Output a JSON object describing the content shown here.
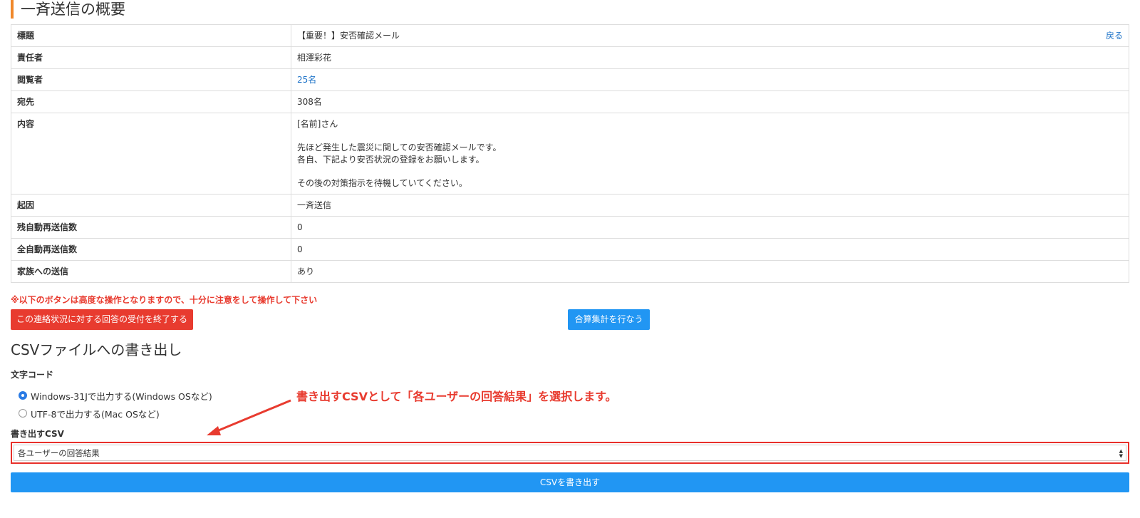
{
  "overview": {
    "title": "一斉送信の概要",
    "back_label": "戻る",
    "rows": [
      {
        "label": "標題",
        "value": "【重要！】安否確認メール"
      },
      {
        "label": "責任者",
        "value": "相澤彩花"
      },
      {
        "label": "閲覧者",
        "value": "25名"
      },
      {
        "label": "宛先",
        "value": "308名"
      },
      {
        "label": "内容",
        "value": "[名前]さん\n\n先ほど発生した震災に関しての安否確認メールです。\n各自、下記より安否状況の登録をお願いします。\n\nその後の対策指示を待機していてください。"
      },
      {
        "label": "起因",
        "value": "一斉送信"
      },
      {
        "label": "残自動再送信数",
        "value": "0"
      },
      {
        "label": "全自動再送信数",
        "value": "0"
      },
      {
        "label": "家族への送信",
        "value": "あり"
      }
    ]
  },
  "actions": {
    "warning": "※以下のボタンは高度な操作となりますので、十分に注意をして操作して下さい",
    "end_button": "この連絡状況に対する回答の受付を終了する",
    "aggregate_button": "合算集計を行なう"
  },
  "csv": {
    "title": "CSVファイルへの書き出し",
    "encoding_label": "文字コード",
    "encoding_options": [
      {
        "label": "Windows-31Jで出力する(Windows OSなど)",
        "checked": true
      },
      {
        "label": "UTF-8で出力する(Mac OSなど)",
        "checked": false
      }
    ],
    "export_label": "書き出すCSV",
    "selected_export": "各ユーザーの回答結果",
    "export_button": "CSVを書き出す"
  },
  "annotation": {
    "text": "書き出すCSVとして「各ユーザーの回答結果」を選択します。",
    "color": "#e83b2f"
  },
  "colors": {
    "accent_orange": "#f0882a",
    "danger": "#e83b2f",
    "primary": "#2196f3",
    "link": "#1e73c8"
  }
}
